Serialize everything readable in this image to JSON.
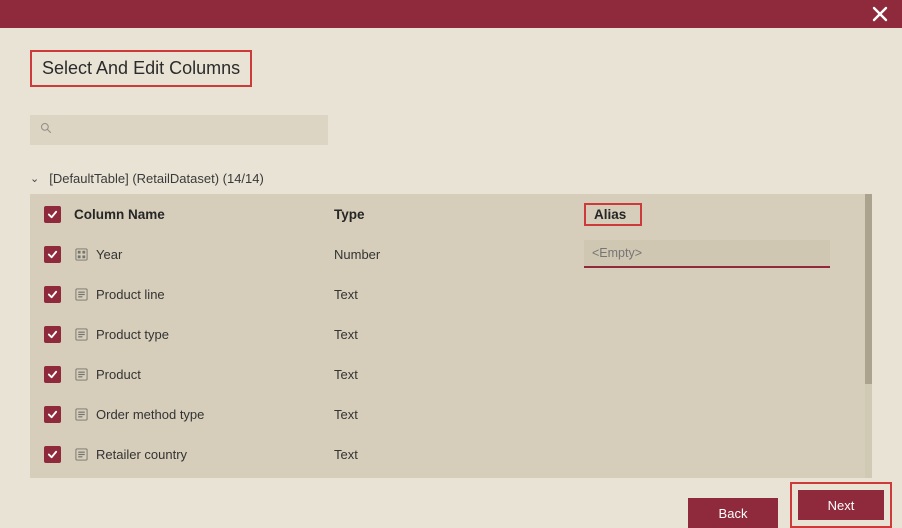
{
  "titlebar": {
    "close_label": "Close"
  },
  "page": {
    "title": "Select And Edit Columns"
  },
  "search": {
    "value": "",
    "placeholder": ""
  },
  "tree": {
    "label": "[DefaultTable] (RetailDataset)  (14/14)"
  },
  "headers": {
    "column_name": "Column Name",
    "type": "Type",
    "alias": "Alias"
  },
  "alias_placeholder": "<Empty>",
  "columns": [
    {
      "name": "Year",
      "type": "Number",
      "icon": "number-column-icon",
      "checked": true,
      "alias_active": true
    },
    {
      "name": "Product line",
      "type": "Text",
      "icon": "text-column-icon",
      "checked": true,
      "alias_active": false
    },
    {
      "name": "Product type",
      "type": "Text",
      "icon": "text-column-icon",
      "checked": true,
      "alias_active": false
    },
    {
      "name": "Product",
      "type": "Text",
      "icon": "text-column-icon",
      "checked": true,
      "alias_active": false
    },
    {
      "name": "Order method type",
      "type": "Text",
      "icon": "text-column-icon",
      "checked": true,
      "alias_active": false
    },
    {
      "name": "Retailer country",
      "type": "Text",
      "icon": "text-column-icon",
      "checked": true,
      "alias_active": false
    }
  ],
  "footer": {
    "back": "Back",
    "next": "Next"
  },
  "colors": {
    "accent": "#8e2a3b",
    "highlight": "#cc3a3a",
    "bg": "#e9e3d5",
    "panel": "#d6ceba"
  }
}
